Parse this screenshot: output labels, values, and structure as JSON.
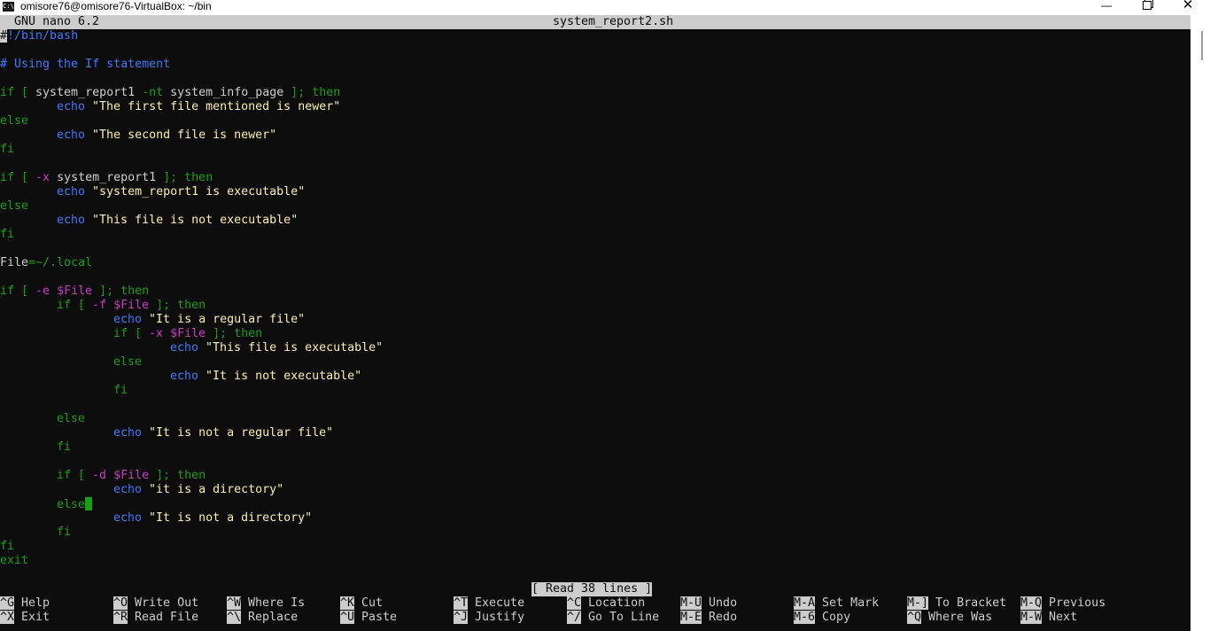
{
  "window": {
    "title": "omisore76@omisore76-VirtualBox: ~/bin",
    "app_icon": "C:\\",
    "minimize": "—",
    "close": "✕"
  },
  "nano": {
    "version": "GNU nano 6.2",
    "filename": "system_report2.sh",
    "status": "[ Read 38 lines ]"
  },
  "code": {
    "l1": "!/bin/bash",
    "l1_cursor": "#",
    "l3": "# Using the If statement",
    "l5": {
      "a": "if [ ",
      "b": "system_report1 ",
      "c": "-nt ",
      "d": "system_info_page ",
      "e": "]; then"
    },
    "l6": {
      "cmd": "echo",
      "str": " \"The first file mentioned is newer\""
    },
    "l7": "else",
    "l8": {
      "cmd": "echo",
      "str": " \"The second file is newer\""
    },
    "l9": "fi",
    "l11": {
      "a": "if [ ",
      "b": "-x ",
      "c": "system_report1 ",
      "d": "]; then"
    },
    "l12": {
      "cmd": "echo",
      "str": " \"system_report1 is executable\""
    },
    "l13": "else",
    "l14": {
      "cmd": "echo",
      "str": " \"This file is not executable\""
    },
    "l15": "fi",
    "l17": {
      "a": "File",
      "b": "=~/",
      "c": ".local"
    },
    "l19": {
      "a": "if [ ",
      "b": "-e ",
      "c": "$File",
      "d": " ]; then"
    },
    "l20": {
      "a": "if [ ",
      "b": "-f ",
      "c": "$File",
      "d": " ]; then"
    },
    "l21": {
      "cmd": "echo",
      "str": " \"It is a regular file\""
    },
    "l22": {
      "a": "if [ ",
      "b": "-x ",
      "c": "$File",
      "d": " ]; then"
    },
    "l23": {
      "cmd": "echo",
      "str": " \"This file is executable\""
    },
    "l24": "else",
    "l25": {
      "cmd": "echo",
      "str": " \"It is not executable\""
    },
    "l26": "fi",
    "l28": "else",
    "l29": {
      "cmd": "echo",
      "str": " \"It is not a regular file\""
    },
    "l30": "fi",
    "l32": {
      "a": "if [ ",
      "b": "-d ",
      "c": "$File",
      "d": " ]; then"
    },
    "l33": {
      "cmd": "echo",
      "str": " \"it is a directory\""
    },
    "l34": "else",
    "l35": {
      "cmd": "echo",
      "str": " \"It is not a directory\""
    },
    "l36": "fi",
    "l37": "fi",
    "l38": "exit"
  },
  "shortcuts": [
    {
      "key": "^G",
      "label": "Help"
    },
    {
      "key": "^X",
      "label": "Exit"
    },
    {
      "key": "^O",
      "label": "Write Out"
    },
    {
      "key": "^R",
      "label": "Read File"
    },
    {
      "key": "^W",
      "label": "Where Is"
    },
    {
      "key": "^\\",
      "label": "Replace"
    },
    {
      "key": "^K",
      "label": "Cut"
    },
    {
      "key": "^U",
      "label": "Paste"
    },
    {
      "key": "^T",
      "label": "Execute"
    },
    {
      "key": "^J",
      "label": "Justify"
    },
    {
      "key": "^C",
      "label": "Location"
    },
    {
      "key": "^/",
      "label": "Go To Line"
    },
    {
      "key": "M-U",
      "label": "Undo"
    },
    {
      "key": "M-E",
      "label": "Redo"
    },
    {
      "key": "M-A",
      "label": "Set Mark"
    },
    {
      "key": "M-6",
      "label": "Copy"
    },
    {
      "key": "M-]",
      "label": "To Bracket"
    },
    {
      "key": "^Q",
      "label": "Where Was"
    },
    {
      "key": "M-Q",
      "label": "Previous"
    },
    {
      "key": "M-W",
      "label": "Next"
    }
  ],
  "colors": {
    "background": "#0c0c0c",
    "keyword": "#13a10e",
    "command": "#3b78ff",
    "string": "#f9f1a5",
    "variable": "#c837c8"
  }
}
